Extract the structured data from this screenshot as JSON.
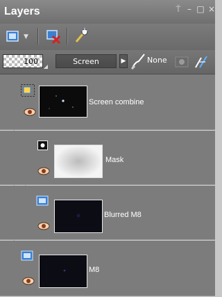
{
  "panel": {
    "title": "Layers"
  },
  "window_controls": {
    "pin": "⍑",
    "minimize": "–",
    "maximize": "□",
    "close": "×"
  },
  "layer_props": {
    "opacity": "100",
    "blend_mode": "Screen",
    "blend_arrow": "▶",
    "brush_mask": "None"
  },
  "layers": [
    {
      "name": "Screen combine",
      "kind": "group",
      "selected": true
    },
    {
      "name": "Mask",
      "kind": "mask"
    },
    {
      "name": "Blurred M8",
      "kind": "raster"
    },
    {
      "name": "M8",
      "kind": "raster"
    }
  ],
  "icons": [
    "new-layer-icon",
    "delete-layer-icon",
    "mask-effect-icon",
    "brush-variant-icon",
    "link-icon",
    "visibility-icon",
    "group-icon",
    "mask-layer-icon"
  ]
}
